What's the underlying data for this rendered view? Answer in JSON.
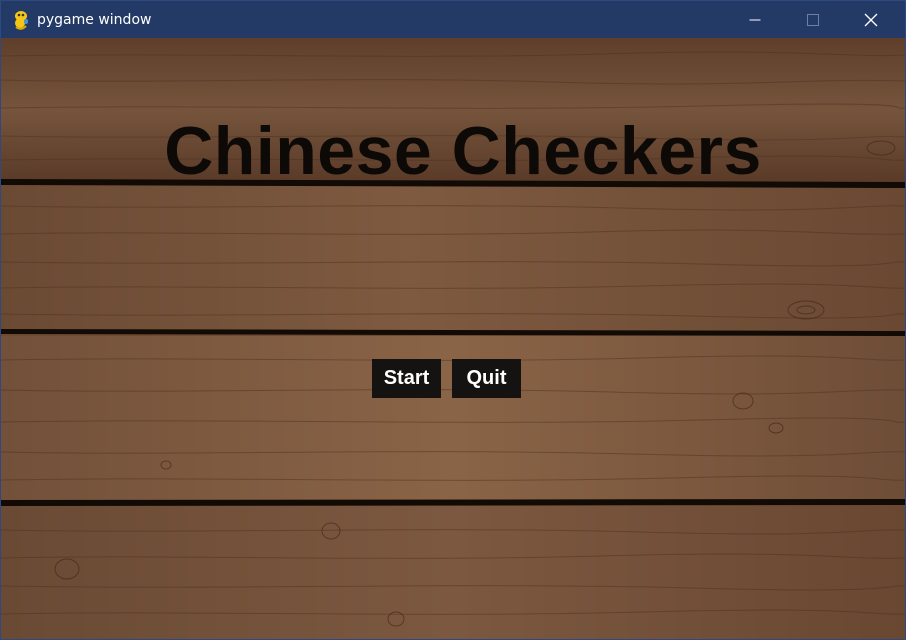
{
  "window": {
    "title": "pygame window",
    "controls": {
      "minimize_icon": "minimize-icon",
      "maximize_icon": "maximize-icon",
      "close_icon": "close-icon"
    },
    "colors": {
      "titlebar": "#233a66",
      "title_text": "#ffffff"
    }
  },
  "game": {
    "title": "Chinese Checkers",
    "buttons": {
      "start_label": "Start",
      "quit_label": "Quit"
    },
    "colors": {
      "wood_base": "#6e4a33",
      "plank_gap": "#120a05",
      "title_text": "#0c0906",
      "button_bg": "#151312",
      "button_text": "#ffffff"
    },
    "background": "wood-planks"
  }
}
